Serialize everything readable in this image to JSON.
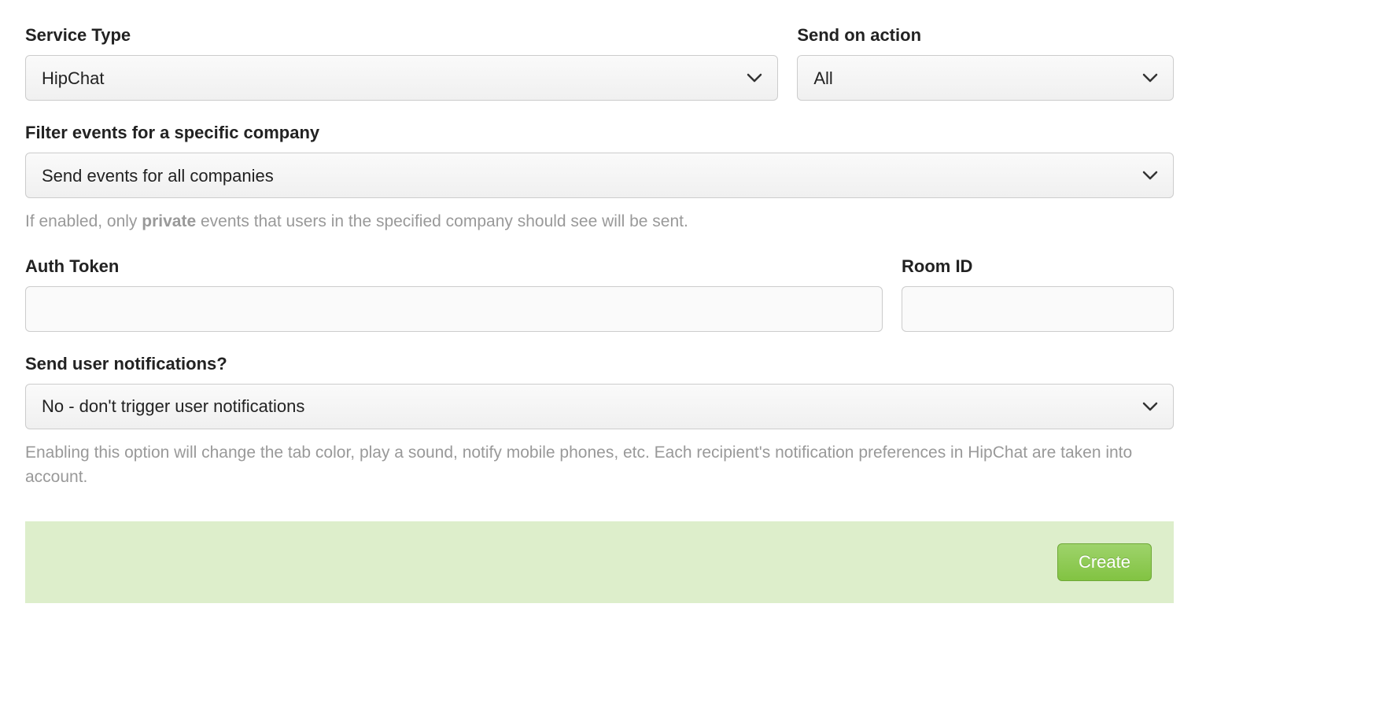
{
  "form": {
    "serviceType": {
      "label": "Service Type",
      "value": "HipChat"
    },
    "sendOnAction": {
      "label": "Send on action",
      "value": "All"
    },
    "filterCompany": {
      "label": "Filter events for a specific company",
      "value": "Send events for all companies",
      "help_prefix": "If enabled, only ",
      "help_strong": "private",
      "help_suffix": " events that users in the specified company should see will be sent."
    },
    "authToken": {
      "label": "Auth Token",
      "value": ""
    },
    "roomId": {
      "label": "Room ID",
      "value": ""
    },
    "sendNotifications": {
      "label": "Send user notifications?",
      "value": "No - don't trigger user notifications",
      "help": "Enabling this option will change the tab color, play a sound, notify mobile phones, etc. Each recipient's notification preferences in HipChat are taken into account."
    }
  },
  "footer": {
    "createButton": "Create"
  }
}
